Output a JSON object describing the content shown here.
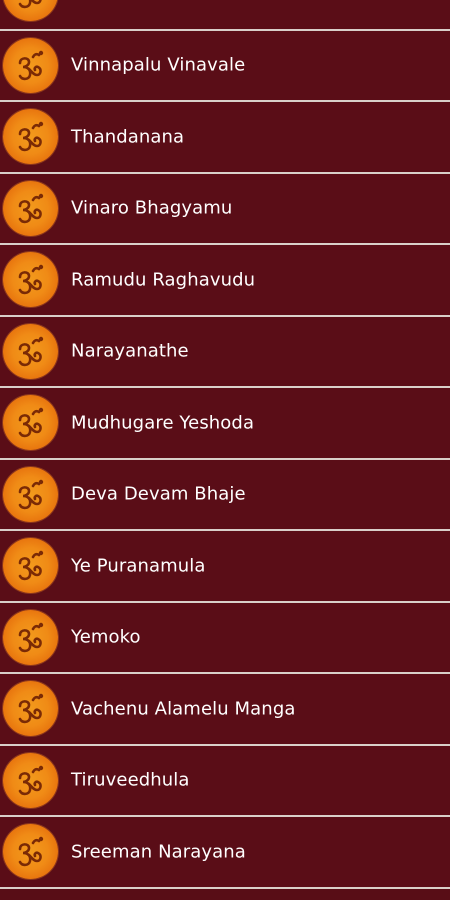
{
  "songs": [
    {
      "title": "",
      "icon": "om-icon"
    },
    {
      "title": "Vinnapalu Vinavale",
      "icon": "om-icon"
    },
    {
      "title": "Thandanana",
      "icon": "om-icon"
    },
    {
      "title": "Vinaro Bhagyamu",
      "icon": "om-icon"
    },
    {
      "title": "Ramudu Raghavudu",
      "icon": "om-icon"
    },
    {
      "title": "Narayanathe",
      "icon": "om-icon"
    },
    {
      "title": "Mudhugare Yeshoda",
      "icon": "om-icon"
    },
    {
      "title": "Deva Devam Bhaje",
      "icon": "om-icon"
    },
    {
      "title": "Ye Puranamula",
      "icon": "om-icon"
    },
    {
      "title": "Yemoko",
      "icon": "om-icon"
    },
    {
      "title": "Vachenu Alamelu Manga",
      "icon": "om-icon"
    },
    {
      "title": "Tiruveedhula",
      "icon": "om-icon"
    },
    {
      "title": "Sreeman Narayana",
      "icon": "om-icon"
    }
  ],
  "colors": {
    "background": "#580d16",
    "divider": "#d9cfc9",
    "text": "#ffffff",
    "icon_orange": "#f08b16"
  }
}
